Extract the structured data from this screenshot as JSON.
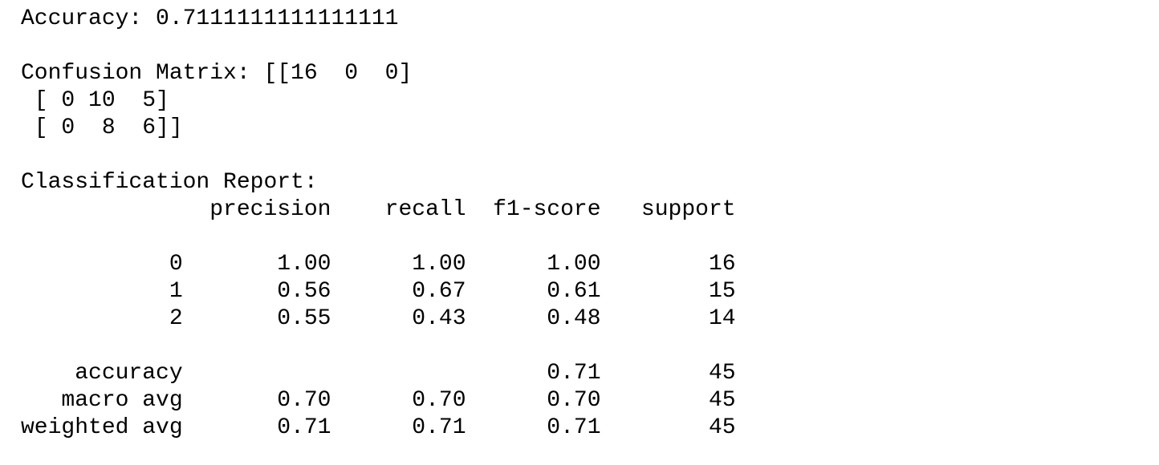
{
  "output": {
    "accuracy_line": "Accuracy: 0.7111111111111111",
    "confusion_lines": [
      "Confusion Matrix: [[16  0  0]",
      " [ 0 10  5]",
      " [ 0  8  6]]"
    ],
    "report_title": "Classification Report:",
    "report_lines": [
      "              precision    recall  f1-score   support",
      "",
      "           0       1.00      1.00      1.00        16",
      "           1       0.56      0.67      0.61        15",
      "           2       0.55      0.43      0.48        14",
      "",
      "    accuracy                           0.71        45",
      "   macro avg       0.70      0.70      0.70        45",
      "weighted avg       0.71      0.71      0.71        45"
    ]
  }
}
